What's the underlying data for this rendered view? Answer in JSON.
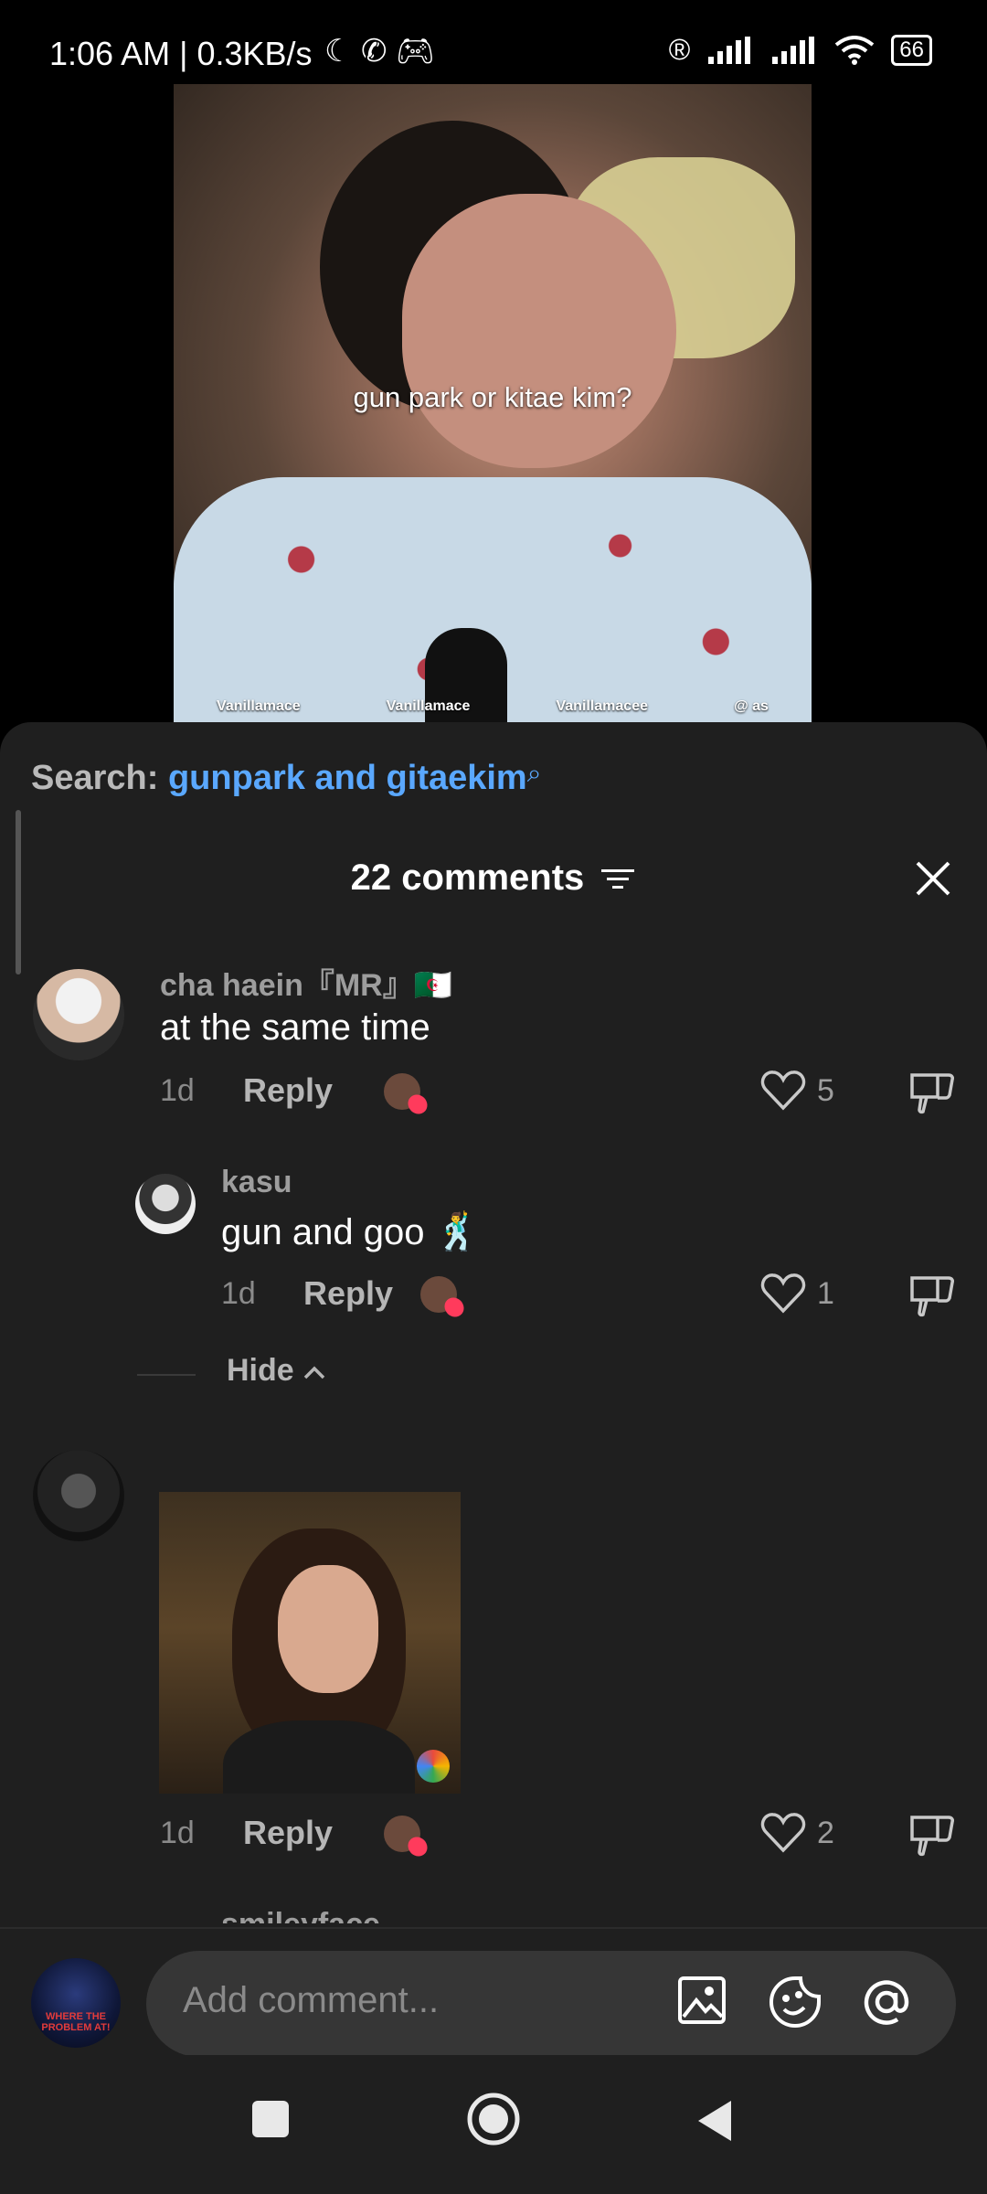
{
  "status_bar": {
    "time": "1:06 AM | 0.3KB/s",
    "icons": [
      "moon-icon",
      "whatsapp-icon",
      "game-icon",
      "registered-icon",
      "signal-icon",
      "signal-icon",
      "wifi-icon"
    ],
    "battery": "66"
  },
  "video": {
    "caption": "gun park or kitae kim?",
    "watermarks": [
      "Vanillamace",
      "Vanillamace",
      "Vanillamacee",
      "@ as"
    ]
  },
  "search": {
    "label": "Search:",
    "query": "gunpark and gitaekim"
  },
  "header": {
    "count_label": "22 comments"
  },
  "comments": [
    {
      "username": "cha haein『MR』🇩🇿",
      "text": "at the same time",
      "age": "1d",
      "reply_label": "Reply",
      "likes": "5"
    },
    {
      "username": "kasu",
      "text": "gun and goo 🕺",
      "age": "1d",
      "reply_label": "Reply",
      "likes": "1"
    },
    {
      "username": "",
      "text": "",
      "age": "1d",
      "reply_label": "Reply",
      "likes": "2"
    }
  ],
  "hide_label": "Hide",
  "partial_username": "smileyface",
  "comment_input": {
    "placeholder": "Add comment..."
  },
  "my_avatar_text": "WHERE THE PROBLEM AT!",
  "colors": {
    "accent": "#5aa8ff",
    "sheet_bg": "#1f1f1f",
    "input_bg": "#363636",
    "like_heart": "#ff3b5c"
  }
}
